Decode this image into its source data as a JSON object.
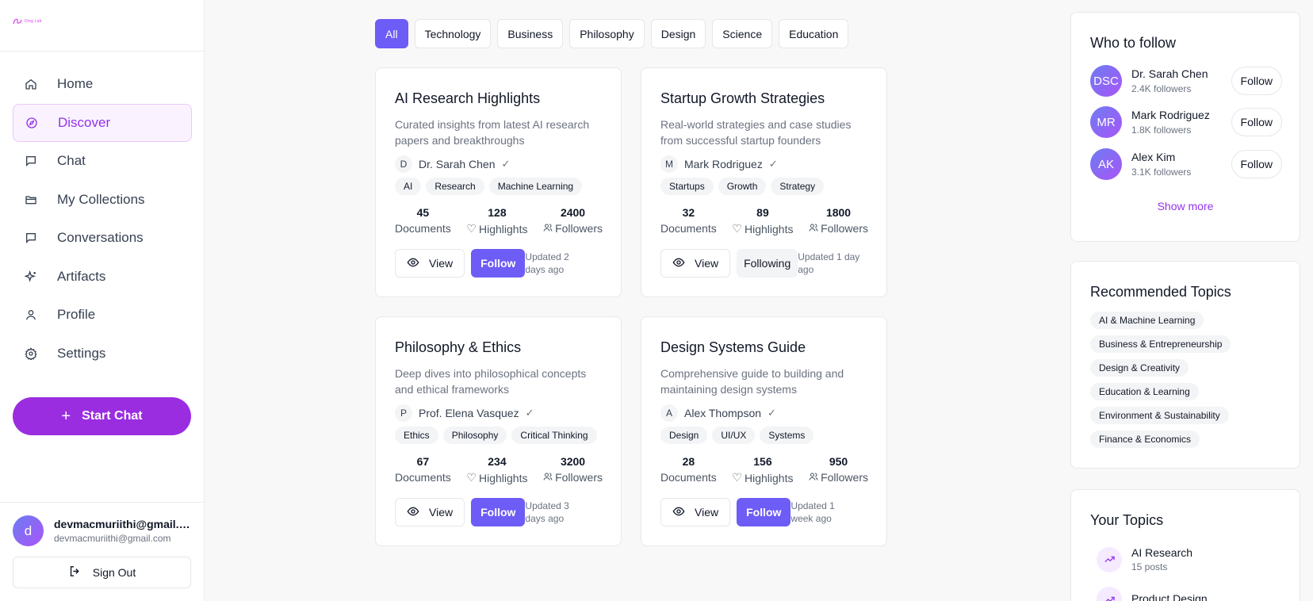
{
  "app": {
    "logo_text": "Ding Lab"
  },
  "sidebar": {
    "items": [
      {
        "label": "Home",
        "icon": "home-icon"
      },
      {
        "label": "Discover",
        "icon": "compass-icon",
        "active": true
      },
      {
        "label": "Chat",
        "icon": "chat-icon"
      },
      {
        "label": "My Collections",
        "icon": "folder-icon"
      },
      {
        "label": "Conversations",
        "icon": "chat-icon"
      },
      {
        "label": "Artifacts",
        "icon": "sparkle-icon"
      },
      {
        "label": "Profile",
        "icon": "user-icon"
      },
      {
        "label": "Settings",
        "icon": "gear-icon"
      }
    ],
    "start_chat": "Start Chat",
    "user": {
      "initial": "d",
      "name": "devmacmuriithi@gmail.c...",
      "email": "devmacmuriithi@gmail.com"
    },
    "sign_out": "Sign Out"
  },
  "filters": [
    "All",
    "Technology",
    "Business",
    "Philosophy",
    "Design",
    "Science",
    "Education"
  ],
  "filters_active": "All",
  "cards": [
    {
      "title": "AI Research Highlights",
      "description": "Curated insights from latest AI research papers and breakthroughs",
      "author_initial": "D",
      "author": "Dr. Sarah Chen",
      "verified": "✓",
      "tags": [
        "AI",
        "Research",
        "Machine Learning"
      ],
      "stats": {
        "documents": "45",
        "highlights": "128",
        "followers": "2400"
      },
      "stat_labels": {
        "documents": "Documents",
        "highlights": "Highlights",
        "followers": "Followers"
      },
      "view_label": "View",
      "follow_label": "Follow",
      "following": false,
      "updated": "Updated 2 days ago"
    },
    {
      "title": "Startup Growth Strategies",
      "description": "Real-world strategies and case studies from successful startup founders",
      "author_initial": "M",
      "author": "Mark Rodriguez",
      "verified": "✓",
      "tags": [
        "Startups",
        "Growth",
        "Strategy"
      ],
      "stats": {
        "documents": "32",
        "highlights": "89",
        "followers": "1800"
      },
      "stat_labels": {
        "documents": "Documents",
        "highlights": "Highlights",
        "followers": "Followers"
      },
      "view_label": "View",
      "follow_label": "Following",
      "following": true,
      "updated": "Updated 1 day ago"
    },
    {
      "title": "Philosophy & Ethics",
      "description": "Deep dives into philosophical concepts and ethical frameworks",
      "author_initial": "P",
      "author": "Prof. Elena Vasquez",
      "verified": "✓",
      "tags": [
        "Ethics",
        "Philosophy",
        "Critical Thinking"
      ],
      "stats": {
        "documents": "67",
        "highlights": "234",
        "followers": "3200"
      },
      "stat_labels": {
        "documents": "Documents",
        "highlights": "Highlights",
        "followers": "Followers"
      },
      "view_label": "View",
      "follow_label": "Follow",
      "following": false,
      "updated": "Updated 3 days ago"
    },
    {
      "title": "Design Systems Guide",
      "description": "Comprehensive guide to building and maintaining design systems",
      "author_initial": "A",
      "author": "Alex Thompson",
      "verified": "✓",
      "tags": [
        "Design",
        "UI/UX",
        "Systems"
      ],
      "stats": {
        "documents": "28",
        "highlights": "156",
        "followers": "950"
      },
      "stat_labels": {
        "documents": "Documents",
        "highlights": "Highlights",
        "followers": "Followers"
      },
      "view_label": "View",
      "follow_label": "Follow",
      "following": false,
      "updated": "Updated 1 week ago"
    }
  ],
  "who_to_follow": {
    "title": "Who to follow",
    "people": [
      {
        "initials": "DSC",
        "name": "Dr. Sarah Chen",
        "followers": "2.4K followers",
        "button": "Follow"
      },
      {
        "initials": "MR",
        "name": "Mark Rodriguez",
        "followers": "1.8K followers",
        "button": "Follow"
      },
      {
        "initials": "AK",
        "name": "Alex Kim",
        "followers": "3.1K followers",
        "button": "Follow"
      }
    ],
    "show_more": "Show more"
  },
  "recommended_topics": {
    "title": "Recommended Topics",
    "topics": [
      "AI & Machine Learning",
      "Business & Entrepreneurship",
      "Design & Creativity",
      "Education & Learning",
      "Environment & Sustainability",
      "Finance & Economics"
    ]
  },
  "your_topics": {
    "title": "Your Topics",
    "topics": [
      {
        "name": "AI Research",
        "posts": "15 posts",
        "icon": "trending-up-icon"
      },
      {
        "name": "Product Design",
        "posts": "",
        "icon": "trending-up-icon"
      }
    ]
  },
  "colors": {
    "accent": "#6d5cf5",
    "brand": "#9b2de0",
    "active_nav_bg": "#faf3ff"
  }
}
